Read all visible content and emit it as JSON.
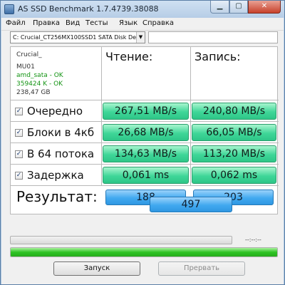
{
  "window": {
    "title": "AS SSD Benchmark 1.7.4739.38088"
  },
  "menu": [
    "Файл",
    "Правка",
    "Вид",
    "Тесты",
    "Язык",
    "Справка"
  ],
  "drive": {
    "selected": "C: Crucial_CT256MX100SSD1 SATA Disk De"
  },
  "info": {
    "model": "Crucial_",
    "firmware": "MU01",
    "driver": "amd_sata - OK",
    "alignment": "359424 K - OK",
    "size": "238,47 GB"
  },
  "columns": {
    "read": "Чтение:",
    "write": "Запись:"
  },
  "tests": [
    {
      "label": "Очередно",
      "checked": true,
      "read": "267,51 MB/s",
      "write": "240,80 MB/s"
    },
    {
      "label": "Блоки в 4кб",
      "checked": true,
      "read": "26,68 MB/s",
      "write": "66,05 MB/s"
    },
    {
      "label": "В 64 потока",
      "checked": true,
      "read": "134,63 MB/s",
      "write": "113,20 MB/s"
    },
    {
      "label": "Задержка",
      "checked": true,
      "read": "0,061 ms",
      "write": "0,062 ms"
    }
  ],
  "result": {
    "label": "Результат:",
    "read": "188",
    "write": "203",
    "total": "497"
  },
  "progress": {
    "time": "--:--:--",
    "test_fraction": 0,
    "total_fraction": 1.0
  },
  "buttons": {
    "start": "Запуск",
    "abort": "Прервать"
  },
  "colors": {
    "value_green": "#3fd698",
    "score_blue": "#41a9f0",
    "progress_green": "#2fc324"
  }
}
